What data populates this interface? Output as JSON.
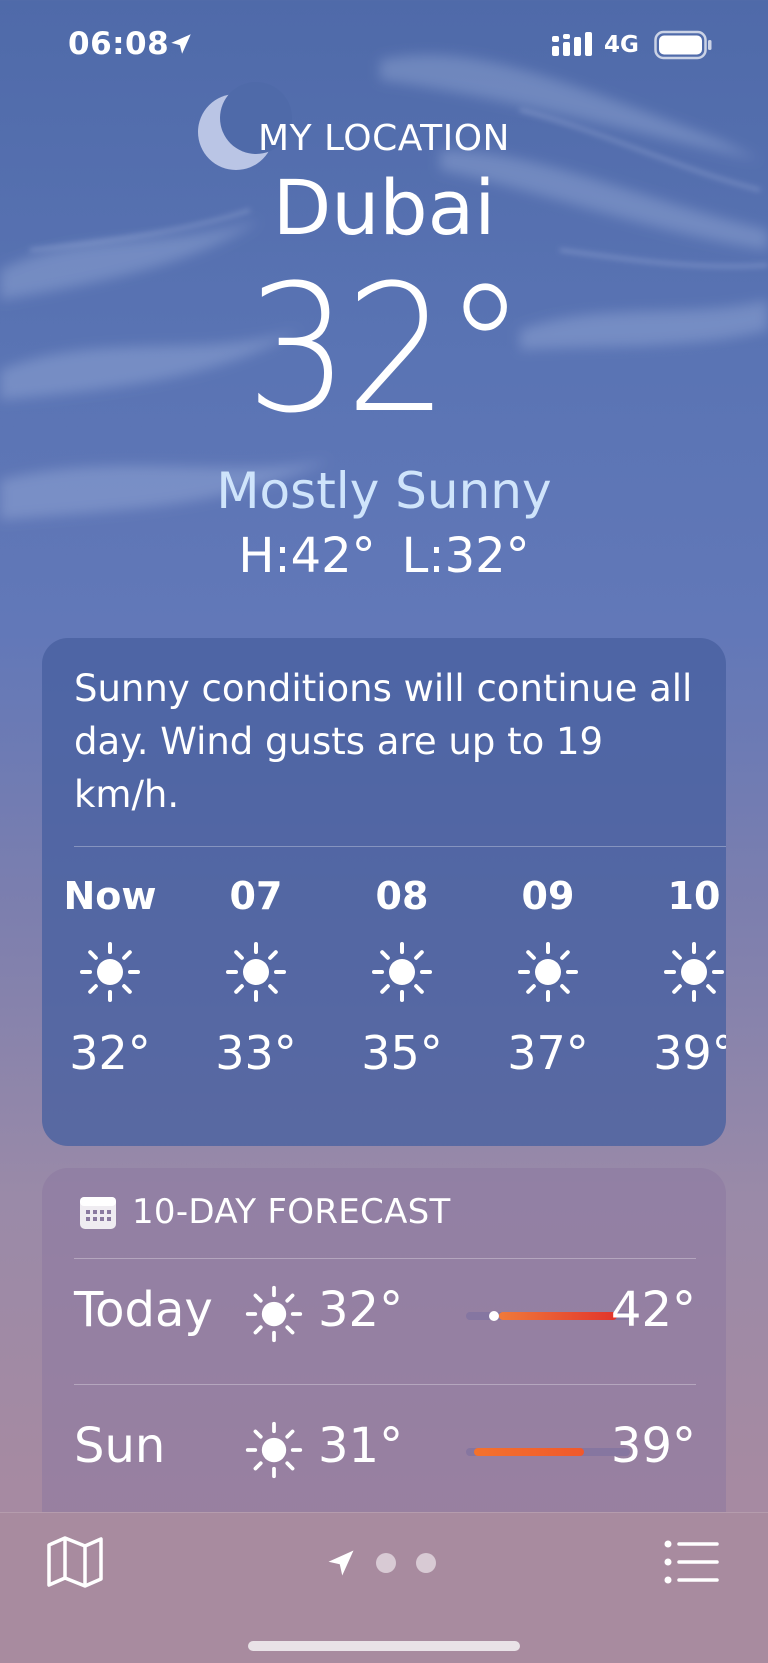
{
  "status_bar": {
    "time": "06:08",
    "network": "4G"
  },
  "header": {
    "location_label": "MY LOCATION",
    "city": "Dubai",
    "temperature": "32°",
    "condition": "Mostly Sunny",
    "high": "H:42°",
    "low": "L:32°"
  },
  "hourly": {
    "summary": "Sunny conditions will continue all day. Wind gusts are up to 19 km/h.",
    "hours": [
      {
        "label": "Now",
        "temp": "32°",
        "icon": "sun-icon"
      },
      {
        "label": "07",
        "temp": "33°",
        "icon": "sun-icon"
      },
      {
        "label": "08",
        "temp": "35°",
        "icon": "sun-icon"
      },
      {
        "label": "09",
        "temp": "37°",
        "icon": "sun-icon"
      },
      {
        "label": "10",
        "temp": "39°",
        "icon": "sun-icon"
      }
    ]
  },
  "forecast": {
    "title": "10-DAY FORECAST",
    "icon": "calendar-icon",
    "days": [
      {
        "day": "Today",
        "low": "32°",
        "high": "42°",
        "icon": "sun-icon",
        "range_start": 0.2,
        "range_end": 0.92,
        "current_marker": 0.17,
        "color_from": "#f07a3a",
        "color_to": "#e2342b"
      },
      {
        "day": "Sun",
        "low": "31°",
        "high": "39°",
        "icon": "sun-icon",
        "range_start": 0.05,
        "range_end": 0.72,
        "color_from": "#f4722c",
        "color_to": "#f0582b"
      }
    ]
  },
  "toolbar": {
    "map_icon": "map-icon",
    "location_icon": "location-arrow-icon",
    "list_icon": "list-icon",
    "page_count": 3,
    "active_page": 0
  },
  "colors": {
    "condition_text": "#cfe4fb",
    "toolbar_bg": "#a88b9f"
  }
}
